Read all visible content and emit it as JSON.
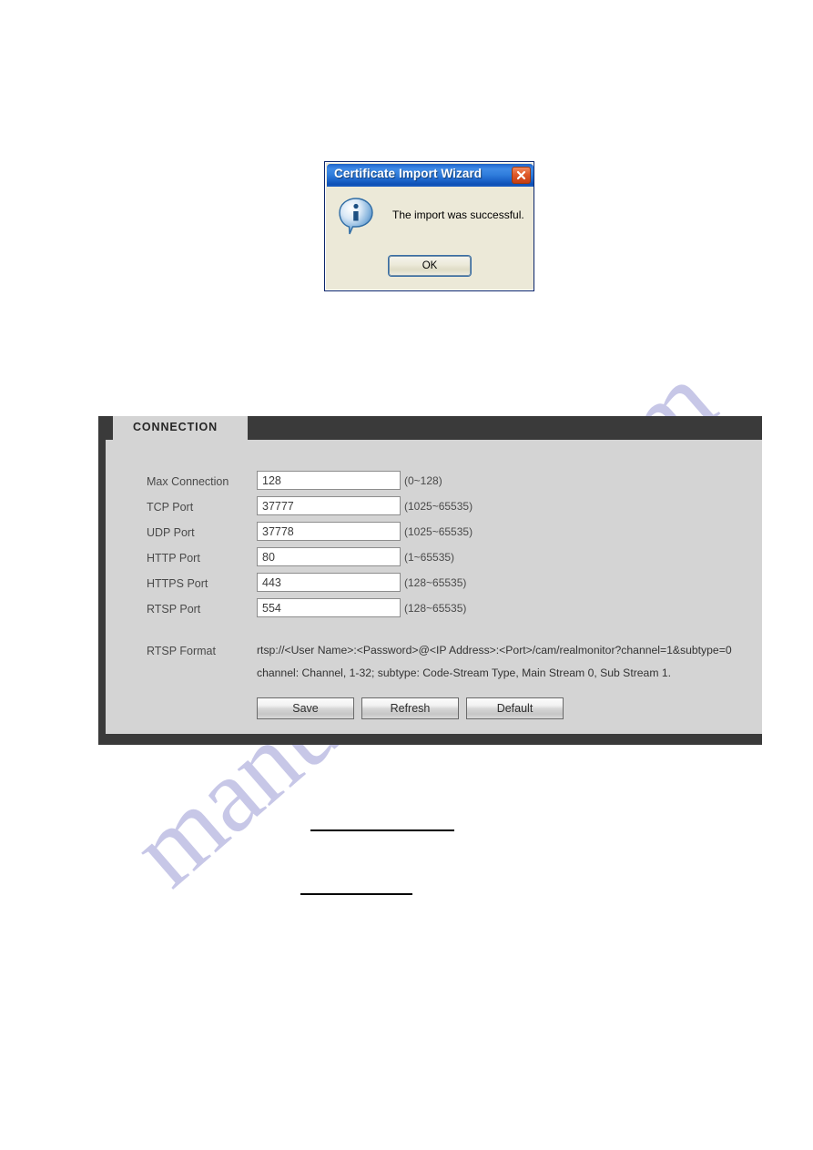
{
  "dialog": {
    "title": "Certificate Import Wizard",
    "message": "The import was successful.",
    "ok_label": "OK",
    "close_icon": "close-icon",
    "info_icon": "info-icon",
    "titlebar_color": "#2f7ddc",
    "close_button_color": "#e05a2a"
  },
  "panel": {
    "tab_label": "CONNECTION",
    "header_color": "#3a3a3a",
    "body_color": "#d4d4d4",
    "rows": [
      {
        "label": "Max Connection",
        "value": "128",
        "hint": "(0~128)"
      },
      {
        "label": "TCP Port",
        "value": "37777",
        "hint": "(1025~65535)"
      },
      {
        "label": "UDP Port",
        "value": "37778",
        "hint": "(1025~65535)"
      },
      {
        "label": "HTTP Port",
        "value": "80",
        "hint": "(1~65535)"
      },
      {
        "label": "HTTPS Port",
        "value": "443",
        "hint": "(128~65535)"
      },
      {
        "label": "RTSP Port",
        "value": "554",
        "hint": "(128~65535)"
      }
    ],
    "rtsp_format": {
      "label": "RTSP Format",
      "line1": "rtsp://<User Name>:<Password>@<IP Address>:<Port>/cam/realmonitor?channel=1&subtype=0",
      "line2": "channel: Channel, 1-32; subtype: Code-Stream Type, Main Stream 0, Sub Stream 1."
    },
    "buttons": {
      "save": "Save",
      "refresh": "Refresh",
      "default": "Default"
    }
  },
  "watermark": {
    "text": "manualshive.com",
    "color": "#9a9ad4"
  }
}
